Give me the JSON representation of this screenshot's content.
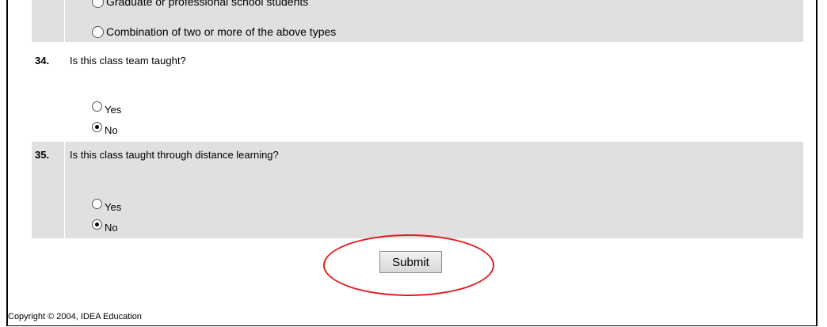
{
  "q33": {
    "options": [
      {
        "label": "Graduate or professional school students",
        "checked": false
      },
      {
        "label": "Combination of two or more of the above types",
        "checked": false
      }
    ]
  },
  "q34": {
    "number": "34.",
    "text": "Is this class team taught?",
    "options": [
      {
        "label": "Yes",
        "checked": false
      },
      {
        "label": "No",
        "checked": true
      }
    ]
  },
  "q35": {
    "number": "35.",
    "text": "Is this class taught through distance learning?",
    "options": [
      {
        "label": "Yes",
        "checked": false
      },
      {
        "label": "No",
        "checked": true
      }
    ]
  },
  "submit": {
    "label": "Submit"
  },
  "annotation": {
    "color": "#e11d21",
    "shape": "ellipse"
  },
  "footer": {
    "copyright": "Copyright © 2004, IDEA Education"
  }
}
